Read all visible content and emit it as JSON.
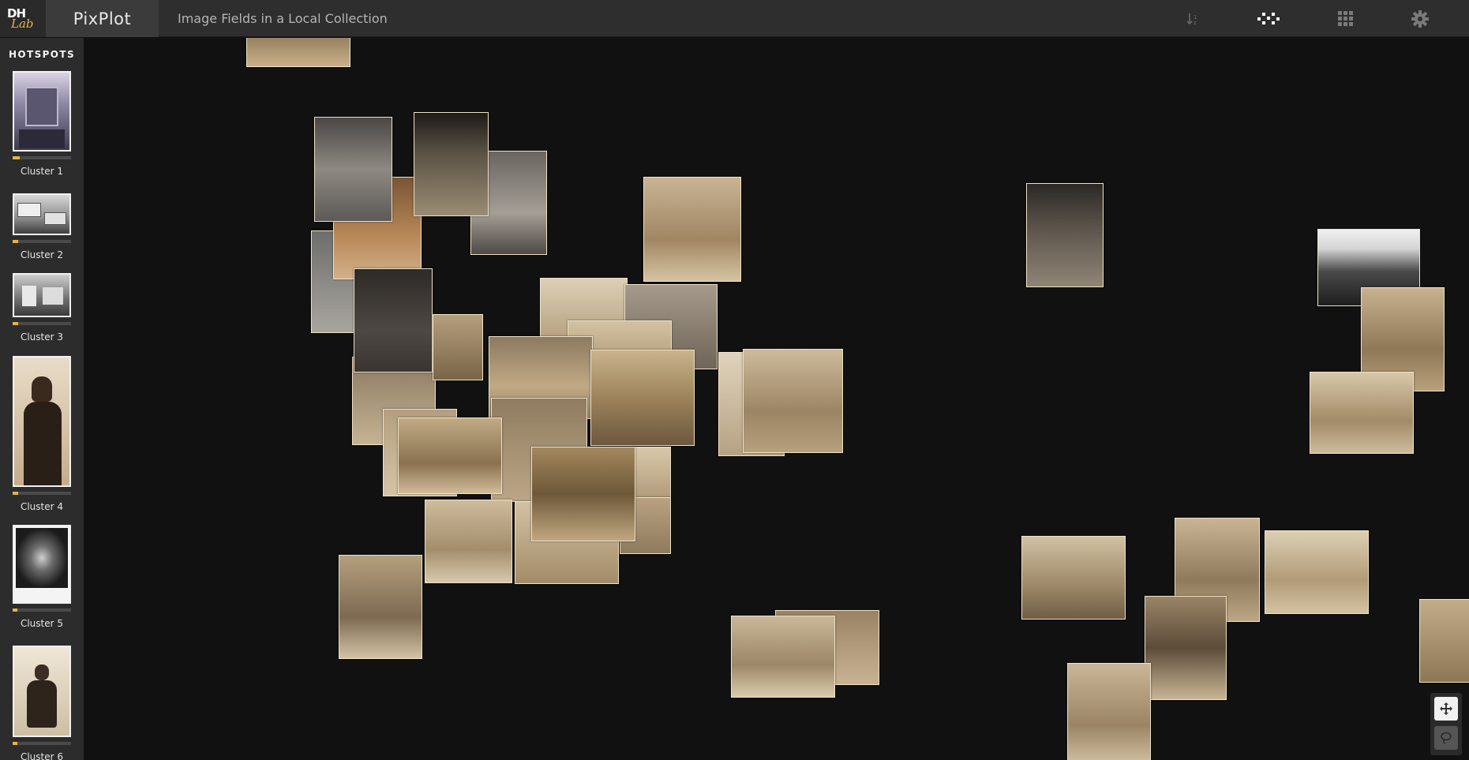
{
  "header": {
    "logo_text_top": "DH",
    "logo_text_bottom": "Lab",
    "app_name": "PixPlot",
    "subtitle": "Image Fields in a Local Collection",
    "icons": [
      "sort-icon",
      "scatter-layout-icon",
      "grid-layout-icon",
      "settings-icon"
    ]
  },
  "sidebar": {
    "heading": "HOTSPOTS",
    "hotspots": [
      {
        "label": "Cluster 1",
        "size_fraction": 0.12
      },
      {
        "label": "Cluster 2",
        "size_fraction": 0.1
      },
      {
        "label": "Cluster 3",
        "size_fraction": 0.09
      },
      {
        "label": "Cluster 4",
        "size_fraction": 0.09
      },
      {
        "label": "Cluster 5",
        "size_fraction": 0.08
      },
      {
        "label": "Cluster 6",
        "size_fraction": 0.08
      }
    ]
  },
  "tools": [
    "pan-tool-icon",
    "lasso-tool-icon"
  ],
  "colors": {
    "background": "#111112",
    "topbar": "#2e2e2f",
    "sidebar": "#2c2c2d",
    "accent": "#e4b343"
  }
}
